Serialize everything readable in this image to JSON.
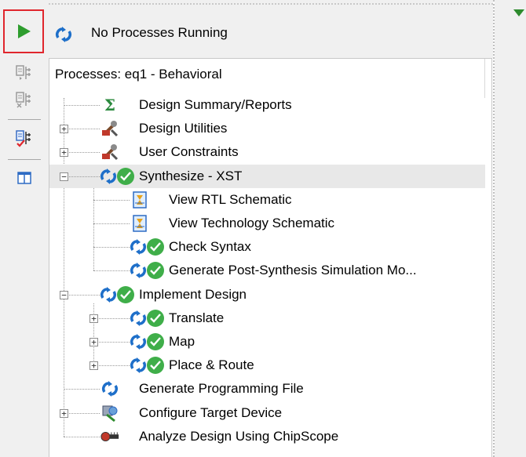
{
  "status": {
    "text": "No Processes Running"
  },
  "panel": {
    "title": "Processes: eq1 - Behavioral"
  },
  "tree": [
    {
      "label": "Design Summary/Reports",
      "icon": "sigma-icon",
      "expander": "none"
    },
    {
      "label": "Design Utilities",
      "icon": "tools-icon",
      "expander": "plus"
    },
    {
      "label": "User Constraints",
      "icon": "tools-icon",
      "expander": "plus"
    },
    {
      "label": "Synthesize - XST",
      "icon": "refresh-check-icon",
      "expander": "minus"
    },
    {
      "label": "View RTL Schematic",
      "icon": "schematic-icon",
      "expander": "none"
    },
    {
      "label": "View Technology Schematic",
      "icon": "schematic-icon",
      "expander": "none"
    },
    {
      "label": "Check Syntax",
      "icon": "refresh-check-icon",
      "expander": "none"
    },
    {
      "label": "Generate Post-Synthesis Simulation Mo...",
      "icon": "refresh-check-icon",
      "expander": "none"
    },
    {
      "label": "Implement Design",
      "icon": "refresh-check-icon",
      "expander": "minus"
    },
    {
      "label": "Translate",
      "icon": "refresh-check-icon",
      "expander": "plus"
    },
    {
      "label": "Map",
      "icon": "refresh-check-icon",
      "expander": "plus"
    },
    {
      "label": "Place & Route",
      "icon": "refresh-check-icon",
      "expander": "plus"
    },
    {
      "label": "Generate Programming File",
      "icon": "refresh-icon",
      "expander": "none"
    },
    {
      "label": "Configure Target Device",
      "icon": "device-icon",
      "expander": "plus"
    },
    {
      "label": "Analyze Design Using ChipScope",
      "icon": "chipscope-icon",
      "expander": "none"
    }
  ],
  "colors": {
    "accent_red": "#e0262d",
    "run_green": "#2e9d2e",
    "check_green": "#3fae49",
    "refresh_blue": "#1e6fc9"
  }
}
